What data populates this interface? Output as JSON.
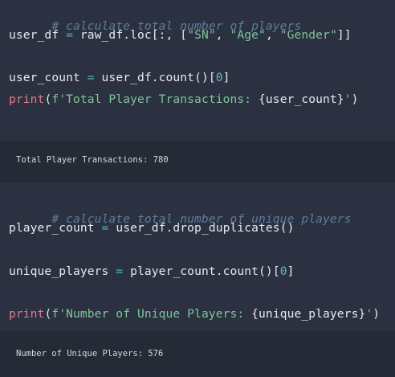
{
  "cell1": {
    "comment": "# calculate total number of players",
    "line1": {
      "lhs": "user_df",
      "eq": " = ",
      "call": "raw_df.loc[:, [",
      "s1": "\"SN\"",
      "c1": ", ",
      "s2": "\"Age\"",
      "c2": ", ",
      "s3": "\"Gender\"",
      "end": "]]"
    },
    "line2": {
      "lhs": "user_count",
      "eq": " = ",
      "call": "user_df.count()[",
      "num": "0",
      "end": "]"
    },
    "line3": {
      "fn": "print",
      "open": "(",
      "fstr_a": "f'Total Player Transactions: ",
      "expr": "{user_count}",
      "fstr_b": "'",
      "close": ")"
    },
    "output": "Total Player Transactions: 780"
  },
  "cell2": {
    "comment": "# calculate total number of unique players",
    "line1": {
      "lhs": "player_count",
      "eq": " = ",
      "call": "user_df.drop_duplicates()"
    },
    "line2": {
      "lhs": "unique_players",
      "eq": " = ",
      "call": "player_count.count()[",
      "num": "0",
      "end": "]"
    },
    "line3": {
      "fn": "print",
      "open": "(",
      "fstr_a": "f'Number of Unique Players: ",
      "expr": "{unique_players}",
      "fstr_b": "'",
      "close": ")"
    },
    "output": "Number of Unique Players: 576"
  },
  "colors": {
    "background": "#2b3140",
    "output_background": "#242a36",
    "comment": "#5f7b9b",
    "string": "#7ec699",
    "number": "#6fb3d2",
    "builtin": "#e07b8c",
    "text": "#e8eaef"
  }
}
